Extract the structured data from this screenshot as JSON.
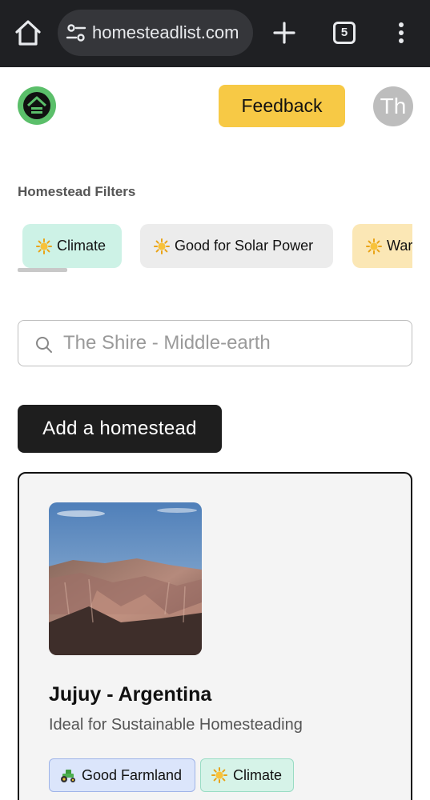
{
  "browser": {
    "url": "homesteadlist.com",
    "tab_count": "5"
  },
  "header": {
    "feedback_label": "Feedback",
    "avatar_initials": "Th"
  },
  "filters": {
    "title": "Homestead Filters",
    "chips": [
      {
        "label": "Climate",
        "icon": "sun-emoji"
      },
      {
        "label": "Good for Solar Power",
        "icon": "sun-emoji"
      },
      {
        "label": "Warm",
        "icon": "sun-emoji"
      }
    ]
  },
  "search": {
    "placeholder": "The Shire - Middle-earth",
    "value": ""
  },
  "actions": {
    "add_label": "Add a homestead"
  },
  "listing": {
    "name": "Jujuy - Argentina",
    "description": "Ideal for Sustainable Homesteading",
    "tags": [
      {
        "label": "Good Farmland",
        "icon": "tractor-emoji"
      },
      {
        "label": "Climate",
        "icon": "sun-emoji"
      }
    ]
  },
  "colors": {
    "feedback_yellow": "#f7c945",
    "chip_green": "#cdf2e6",
    "chip_gray": "#ececec",
    "chip_yellow": "#fbe7b5",
    "button_dark": "#1e1e1e"
  }
}
